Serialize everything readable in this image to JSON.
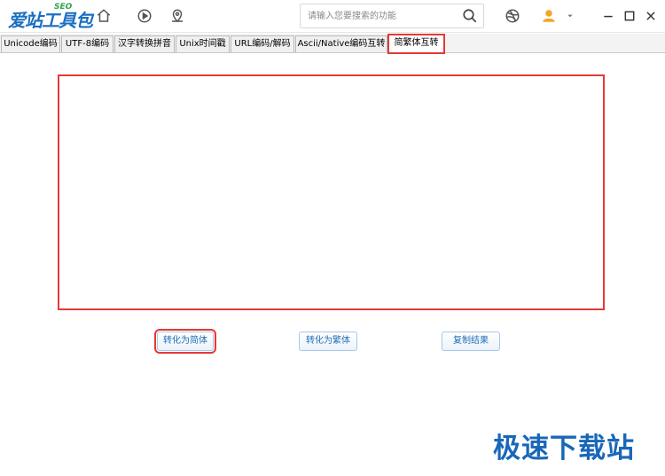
{
  "app": {
    "logo_text": "爱站工具包",
    "logo_sub": "SEO"
  },
  "toolbar": {
    "icons": [
      "home-icon",
      "play-icon",
      "location-icon"
    ]
  },
  "search": {
    "placeholder": "请输入您要搜索的功能",
    "value": ""
  },
  "header_right": {
    "icons": [
      "dribbble-icon",
      "user-icon",
      "dropdown-arrow-icon",
      "minimize-icon",
      "maximize-icon",
      "close-icon"
    ]
  },
  "tabs": [
    {
      "label": "Unicode编码",
      "active": false
    },
    {
      "label": "UTF-8编码",
      "active": false
    },
    {
      "label": "汉字转换拼音",
      "active": false
    },
    {
      "label": "Unix时间戳",
      "active": false
    },
    {
      "label": "URL编码/解码",
      "active": false
    },
    {
      "label": "Ascii/Native编码互转",
      "active": false
    },
    {
      "label": "简繁体互转",
      "active": true
    }
  ],
  "editor": {
    "value": ""
  },
  "buttons": {
    "to_simplified": "转化为简体",
    "to_traditional": "转化为繁体",
    "copy_result": "复制结果"
  },
  "watermark": "极速下载站",
  "colors": {
    "accent_blue": "#1a6fc2",
    "highlight_red": "#e53935",
    "button_text": "#1f6fb5"
  }
}
